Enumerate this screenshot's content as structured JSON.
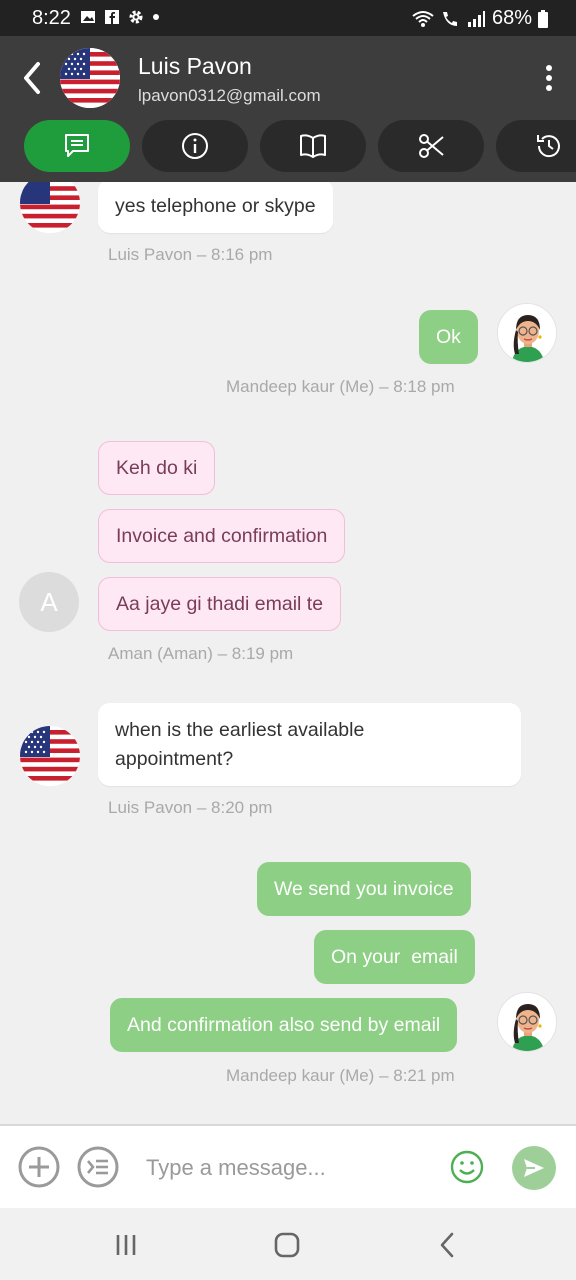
{
  "status_bar": {
    "time": "8:22",
    "battery": "68%"
  },
  "header": {
    "contact_name": "Luis Pavon",
    "contact_email": "lpavon0312@gmail.com",
    "tabs": [
      {
        "name": "chat",
        "icon": "chat-icon",
        "active": true
      },
      {
        "name": "info",
        "icon": "info-icon",
        "active": false
      },
      {
        "name": "notes",
        "icon": "book-icon",
        "active": false
      },
      {
        "name": "tools",
        "icon": "scissors-icon",
        "active": false
      },
      {
        "name": "history",
        "icon": "history-icon",
        "active": false
      }
    ]
  },
  "messages": {
    "m1": {
      "text": "yes telephone or skype",
      "meta": "Luis Pavon – 8:16 pm"
    },
    "m2": {
      "text": "Ok",
      "meta": "Mandeep kaur (Me) – 8:18 pm"
    },
    "m3": {
      "texts": [
        "Keh do ki",
        "Invoice and confirmation",
        "Aa jaye gi thadi email te"
      ],
      "avatar_letter": "A",
      "meta": "Aman (Aman) – 8:19 pm"
    },
    "m4": {
      "text": "when is the earliest available appointment?",
      "meta": "Luis Pavon – 8:20 pm"
    },
    "m5": {
      "texts": [
        "We send you invoice",
        "On your  email",
        "And confirmation also send by email"
      ],
      "meta": "Mandeep kaur (Me) – 8:21 pm"
    }
  },
  "composer": {
    "placeholder": "Type a message..."
  },
  "colors": {
    "accent": "#1f9c3b",
    "outgoing_bubble": "#8dcf85",
    "header": "#3d3d3d"
  }
}
